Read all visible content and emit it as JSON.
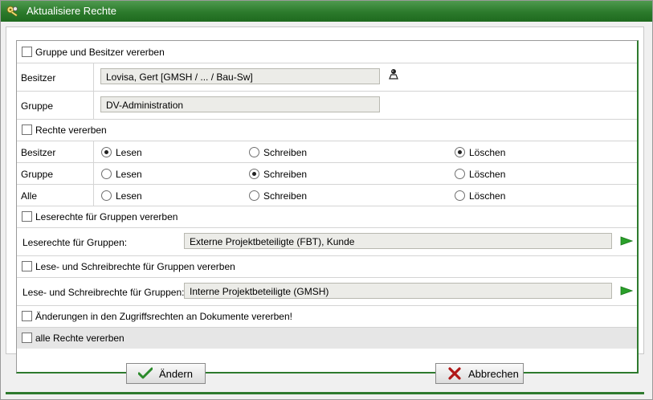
{
  "window": {
    "title": "Aktualisiere Rechte"
  },
  "inherit_group_owner": {
    "label": "Gruppe und Besitzer vererben",
    "checked": false
  },
  "owner": {
    "label": "Besitzer",
    "value": "Lovisa, Gert [GMSH / ... / Bau-Sw]"
  },
  "group": {
    "label": "Gruppe",
    "value": "DV-Administration"
  },
  "inherit_rights": {
    "label": "Rechte vererben",
    "checked": false
  },
  "permissions": {
    "read_label": "Lesen",
    "write_label": "Schreiben",
    "delete_label": "Löschen",
    "rows": [
      {
        "label": "Besitzer",
        "read": true,
        "write": false,
        "delete": true
      },
      {
        "label": "Gruppe",
        "read": false,
        "write": true,
        "delete": false
      },
      {
        "label": "Alle",
        "read": false,
        "write": false,
        "delete": false
      }
    ]
  },
  "inherit_read_groups": {
    "label": "Leserechte für Gruppen vererben",
    "checked": false
  },
  "read_groups": {
    "label": "Leserechte für Gruppen:",
    "value": "Externe Projektbeteiligte (FBT), Kunde"
  },
  "inherit_readwrite_groups": {
    "label": "Lese- und Schreibrechte für Gruppen vererben",
    "checked": false
  },
  "readwrite_groups": {
    "label": "Lese- und Schreibrechte für Gruppen:",
    "value": "Interne Projektbeteiligte (GMSH)"
  },
  "inherit_document_changes": {
    "label": "Änderungen in den Zugriffsrechten an Dokumente vererben!",
    "checked": false
  },
  "inherit_all": {
    "label": "alle Rechte vererben",
    "checked": false
  },
  "buttons": {
    "save_label": "Ändern",
    "cancel_label": "Abbrechen"
  },
  "colors": {
    "title_green": "#2b7a2b",
    "accent_green": "#2e7a2e",
    "arrow_green": "#2aa02a",
    "cancel_red": "#b01818"
  }
}
